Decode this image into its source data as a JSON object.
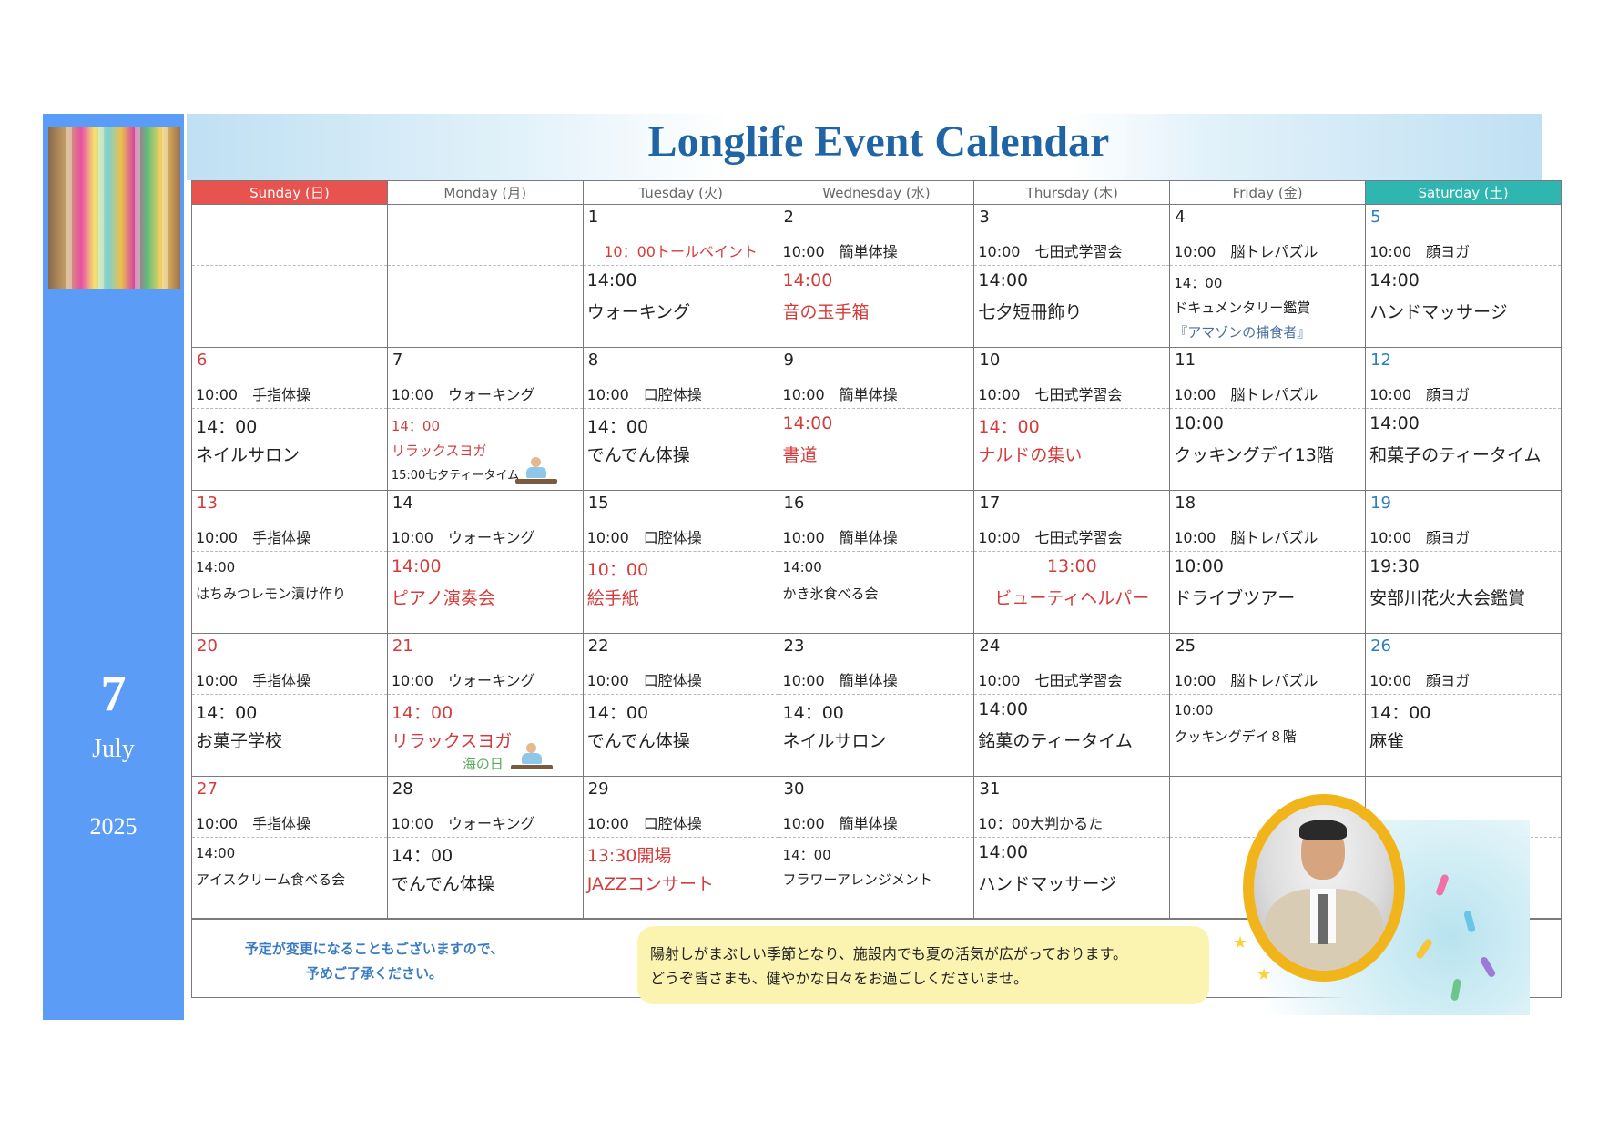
{
  "title": "Longlife Event Calendar",
  "side": {
    "day": "7",
    "month": "July",
    "year": "2025"
  },
  "headers": [
    "Sunday (日)",
    "Monday (月)",
    "Tuesday (火)",
    "Wednesday (水)",
    "Thursday (木)",
    "Friday (金)",
    "Saturday (土)"
  ],
  "weeks": [
    [
      {},
      {},
      {
        "day": "1",
        "am": "10：00トールペイント",
        "pm1": "14:00",
        "pm2": "ウォーキング"
      },
      {
        "day": "2",
        "am": "10:00　簡単体操",
        "pm1": "14:00",
        "pm2": "音の玉手箱"
      },
      {
        "day": "3",
        "am": "10:00　七田式学習会",
        "pm1": "14:00",
        "pm2": "七夕短冊飾り"
      },
      {
        "day": "4",
        "am": "10:00　脳トレパズル",
        "pm1": "14：00",
        "pm2": "ドキュメンタリー鑑賞",
        "pm3": "『アマゾンの捕食者』"
      },
      {
        "day": "5",
        "am": "10:00　顔ヨガ",
        "pm1": "14:00",
        "pm2": "ハンドマッサージ"
      }
    ],
    [
      {
        "day": "6",
        "am": "10:00　手指体操",
        "pm1": "14：00",
        "pm2": "ネイルサロン"
      },
      {
        "day": "7",
        "am": "10:00　ウォーキング",
        "pm1": "14：00",
        "pm2": "リラックスヨガ",
        "pm3": "15:00七夕ティータイム"
      },
      {
        "day": "8",
        "am": "10:00　口腔体操",
        "pm1": "14：00",
        "pm2": "でんでん体操"
      },
      {
        "day": "9",
        "am": "10:00　簡単体操",
        "pm1": "14:00",
        "pm2": "書道"
      },
      {
        "day": "10",
        "am": "10:00　七田式学習会",
        "pm1": "14：00",
        "pm2": "ナルドの集い"
      },
      {
        "day": "11",
        "am": "10:00　脳トレパズル",
        "pm1": "10:00",
        "pm2": "クッキングデイ13階"
      },
      {
        "day": "12",
        "am": "10:00　顔ヨガ",
        "pm1": "14:00",
        "pm2": "和菓子のティータイム"
      }
    ],
    [
      {
        "day": "13",
        "am": "10:00　手指体操",
        "pm1": "14:00",
        "pm2": "はちみつレモン漬け作り"
      },
      {
        "day": "14",
        "am": "10:00　ウォーキング",
        "pm1": "14:00",
        "pm2": "ピアノ演奏会"
      },
      {
        "day": "15",
        "am": "10:00　口腔体操",
        "pm1": "10：00",
        "pm2": "絵手紙"
      },
      {
        "day": "16",
        "am": "10:00　簡単体操",
        "pm1": "14:00",
        "pm2": "かき氷食べる会"
      },
      {
        "day": "17",
        "am": "10:00　七田式学習会",
        "pm1": "13:00",
        "pm2": "ビューティヘルパー"
      },
      {
        "day": "18",
        "am": "10:00　脳トレパズル",
        "pm1": "10:00",
        "pm2": "ドライブツアー"
      },
      {
        "day": "19",
        "am": "10:00　顔ヨガ",
        "pm1": "19:30",
        "pm2": "安部川花火大会鑑賞"
      }
    ],
    [
      {
        "day": "20",
        "am": "10:00　手指体操",
        "pm1": "14：00",
        "pm2": "お菓子学校"
      },
      {
        "day": "21",
        "am": "10:00　ウォーキング",
        "pm1": "14：00",
        "pm2": "リラックスヨガ",
        "holiday": "海の日"
      },
      {
        "day": "22",
        "am": "10:00　口腔体操",
        "pm1": "14：00",
        "pm2": "でんでん体操"
      },
      {
        "day": "23",
        "am": "10:00　簡単体操",
        "pm1": "14：00",
        "pm2": "ネイルサロン"
      },
      {
        "day": "24",
        "am": "10:00　七田式学習会",
        "pm1": "14:00",
        "pm2": "銘菓のティータイム"
      },
      {
        "day": "25",
        "am": "10:00　脳トレパズル",
        "pm1": "10:00",
        "pm2": "クッキングデイ８階"
      },
      {
        "day": "26",
        "am": "10:00　顔ヨガ",
        "pm1": "14：00",
        "pm2": "麻雀"
      }
    ],
    [
      {
        "day": "27",
        "am": "10:00　手指体操",
        "pm1": "14:00",
        "pm2": "アイスクリーム食べる会"
      },
      {
        "day": "28",
        "am": "10:00　ウォーキング",
        "pm1": "14：00",
        "pm2": "でんでん体操"
      },
      {
        "day": "29",
        "am": "10:00　口腔体操",
        "pm1": "13:30開場",
        "pm2": "JAZZコンサート"
      },
      {
        "day": "30",
        "am": "10:00　簡単体操",
        "pm1": "14：00",
        "pm2": "フラワーアレンジメント"
      },
      {
        "day": "31",
        "am": "10：00大判かるた",
        "pm1": "14:00",
        "pm2": "ハンドマッサージ"
      },
      {},
      {}
    ]
  ],
  "note": {
    "left_line1": "予定が変更になることもございますので、",
    "left_line2": "予めご了承ください。",
    "bubble_line1": "陽射しがまぶしい季節となり、施設内でも夏の活気が広がっております。",
    "bubble_line2": "どうぞ皆さまも、健やかな日々をお過ごしくださいませ。"
  },
  "colors": {
    "sunday": "#e8524f",
    "saturday": "#2fb6b0",
    "accent": "#1f64a5",
    "side": "#5b9cf6",
    "event_red": "#d43c3c"
  }
}
